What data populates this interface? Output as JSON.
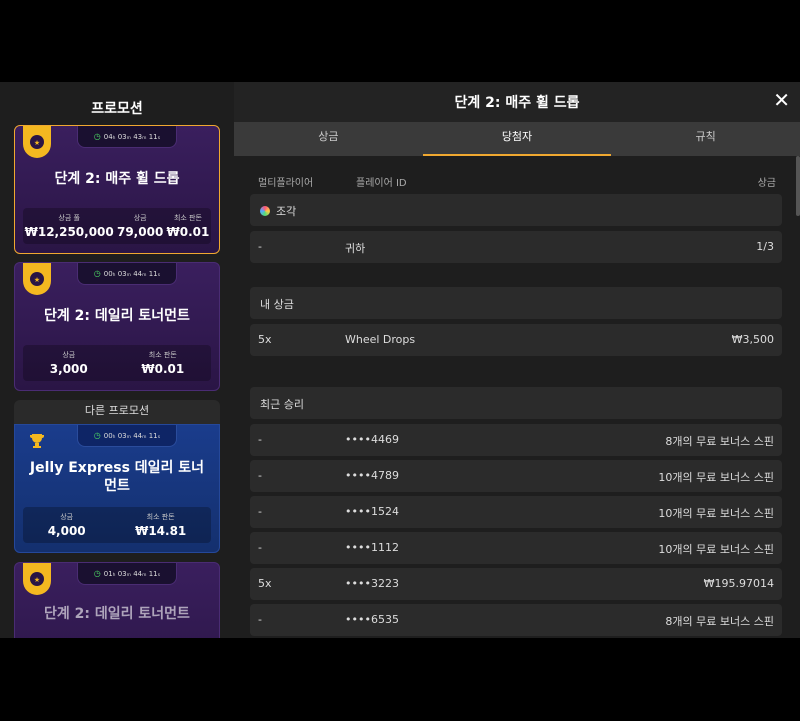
{
  "left": {
    "title": "프로모션",
    "other_header": "다른 프로모션",
    "promos": [
      {
        "timer": "04ₕ 03ₘ 43ₘ 11ₛ",
        "title": "단계 2: 매주 휠 드롭",
        "stats": [
          {
            "label": "상금 풀",
            "value": "₩12,250,000"
          },
          {
            "label": "상금",
            "value": "79,000"
          },
          {
            "label": "최소 판돈",
            "value": "₩0.01"
          }
        ]
      },
      {
        "timer": "00ₕ 03ₘ 44ₘ 11ₛ",
        "title": "단계 2: 데일리 토너먼트",
        "stats": [
          {
            "label": "상금",
            "value": "3,000"
          },
          {
            "label": "최소 판돈",
            "value": "₩0.01"
          }
        ]
      },
      {
        "timer": "00ₕ 03ₘ 44ₘ 11ₛ",
        "title": "Jelly Express 데일리 토너먼트",
        "stats": [
          {
            "label": "상금",
            "value": "4,000"
          },
          {
            "label": "최소 판돈",
            "value": "₩14.81"
          }
        ]
      },
      {
        "timer": "01ₕ 03ₘ 44ₘ 11ₛ",
        "title": "단계 2: 데일리 토너먼트"
      }
    ]
  },
  "right": {
    "title": "단계 2: 매주 휠 드롭",
    "close": "✕",
    "tabs": [
      "상금",
      "당첨자",
      "규칙"
    ],
    "headers": {
      "col1": "멀티플라이어",
      "col2": "플레이어 ID",
      "col3": "상금"
    },
    "pieces_label": "조각",
    "you_row": {
      "c1": "-",
      "c2": "귀하",
      "c3": "1/3"
    },
    "my_prize_label": "내 상금",
    "my_prize_row": {
      "c1": "5x",
      "c2": "Wheel Drops",
      "c3": "₩3,500"
    },
    "recent_label": "최근 승리",
    "recent": [
      {
        "c1": "-",
        "c2": "••••4469",
        "c3": "8개의 무료 보너스 스핀"
      },
      {
        "c1": "-",
        "c2": "••••4789",
        "c3": "10개의 무료 보너스 스핀"
      },
      {
        "c1": "-",
        "c2": "••••1524",
        "c3": "10개의 무료 보너스 스핀"
      },
      {
        "c1": "-",
        "c2": "••••1112",
        "c3": "10개의 무료 보너스 스핀"
      },
      {
        "c1": "5x",
        "c2": "••••3223",
        "c3": "₩195.97014"
      },
      {
        "c1": "-",
        "c2": "••••6535",
        "c3": "8개의 무료 보너스 스핀"
      }
    ]
  }
}
